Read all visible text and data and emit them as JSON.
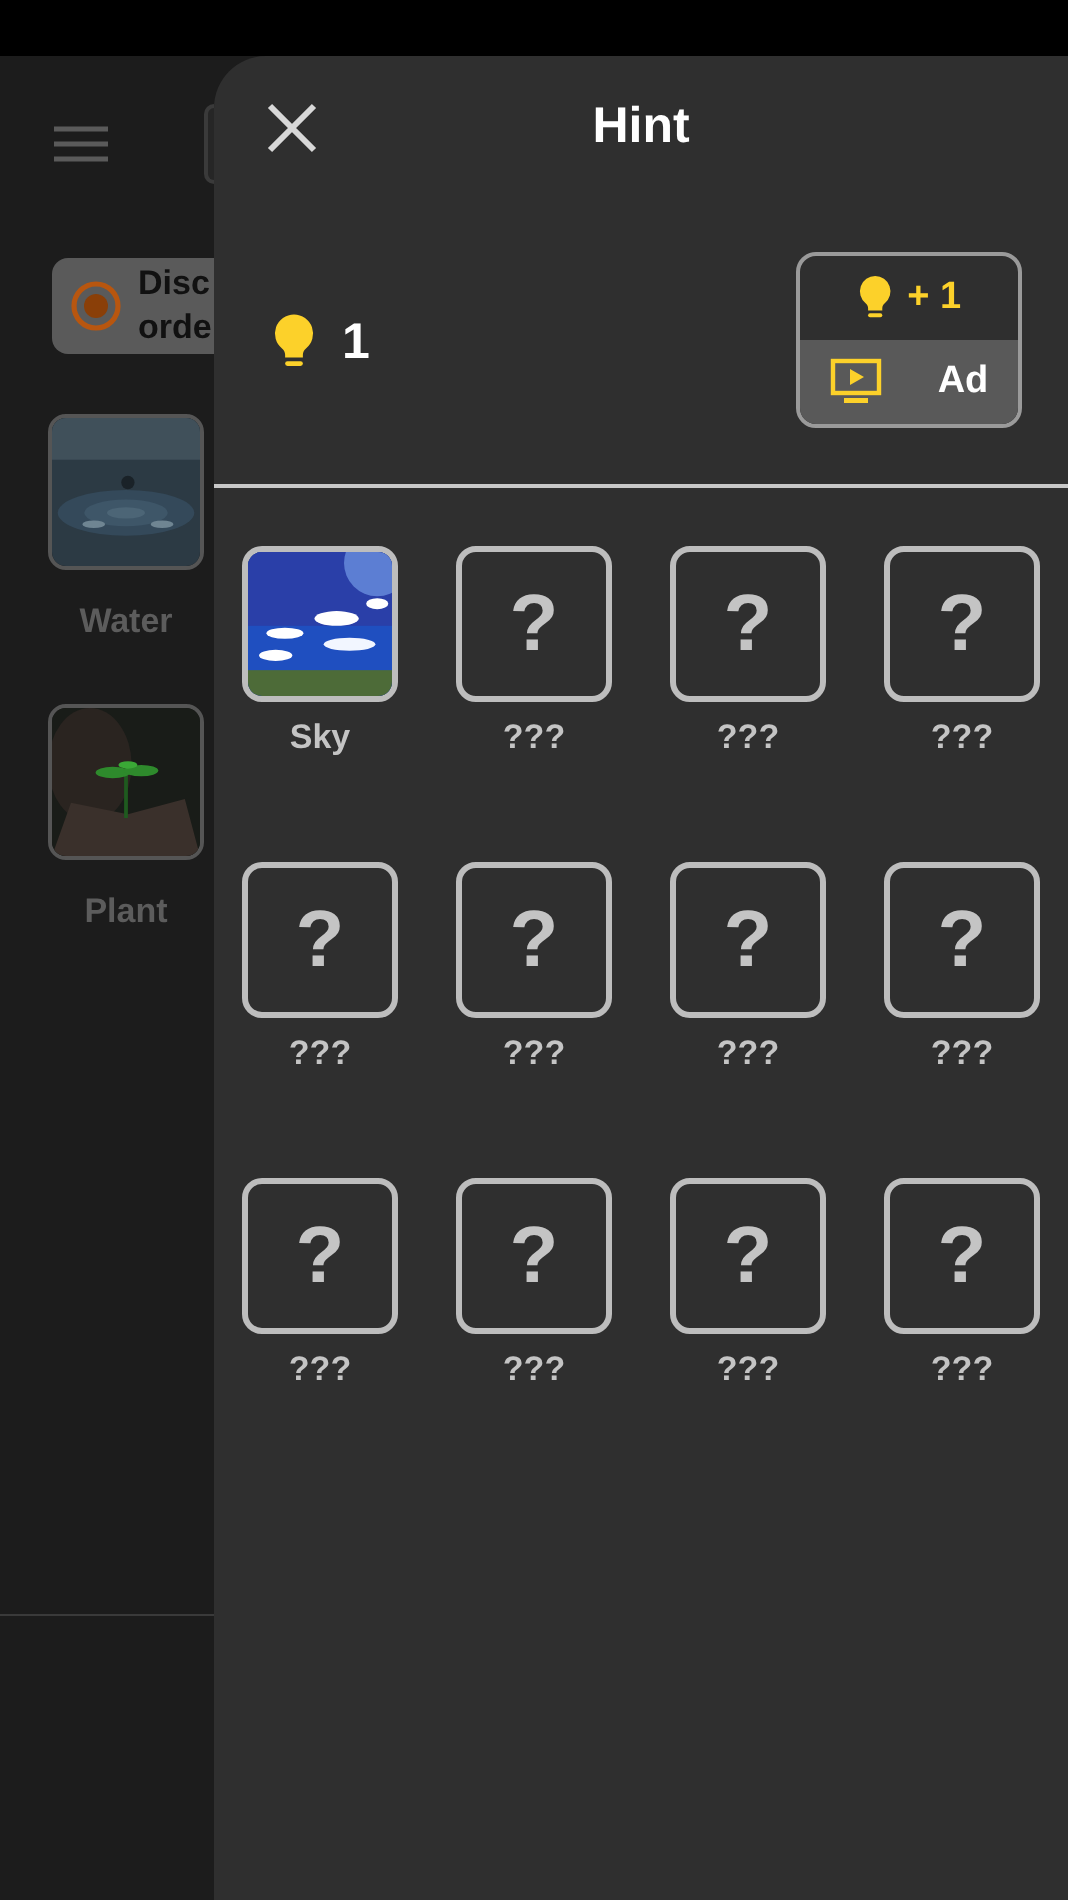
{
  "background": {
    "discount_badge": {
      "lines": [
        "Disc",
        "orde"
      ]
    },
    "items": [
      {
        "label": "Water"
      },
      {
        "label": "Plant"
      }
    ]
  },
  "hint_panel": {
    "title": "Hint",
    "hint_count": "1",
    "reward": "+ 1",
    "ad_label": "Ad",
    "tiles": [
      {
        "kind": "picture",
        "label": "Sky"
      },
      {
        "kind": "locked",
        "symbol": "?",
        "label": "???"
      },
      {
        "kind": "locked",
        "symbol": "?",
        "label": "???"
      },
      {
        "kind": "locked",
        "symbol": "?",
        "label": "???"
      },
      {
        "kind": "locked",
        "symbol": "?",
        "label": "???"
      },
      {
        "kind": "locked",
        "symbol": "?",
        "label": "???"
      },
      {
        "kind": "locked",
        "symbol": "?",
        "label": "???"
      },
      {
        "kind": "locked",
        "symbol": "?",
        "label": "???"
      },
      {
        "kind": "locked",
        "symbol": "?",
        "label": "???"
      },
      {
        "kind": "locked",
        "symbol": "?",
        "label": "???"
      },
      {
        "kind": "locked",
        "symbol": "?",
        "label": "???"
      },
      {
        "kind": "locked",
        "symbol": "?",
        "label": "???"
      }
    ]
  }
}
